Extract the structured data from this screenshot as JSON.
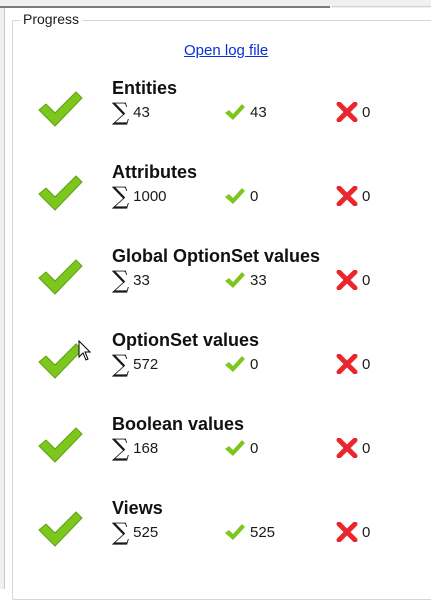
{
  "groupbox": {
    "title": "Progress"
  },
  "log_link": "Open log file",
  "colors": {
    "success": "#7dc61e",
    "error": "#e8262b",
    "link": "#0a2fd6"
  },
  "icons": {
    "total": "sigma-icon",
    "success": "check-icon",
    "error": "x-icon",
    "status": "large-check-icon"
  },
  "sections": [
    {
      "title": "Entities",
      "total": "43",
      "ok": "43",
      "errors": "0"
    },
    {
      "title": "Attributes",
      "total": "1000",
      "ok": "0",
      "errors": "0"
    },
    {
      "title": "Global OptionSet values",
      "total": "33",
      "ok": "33",
      "errors": "0"
    },
    {
      "title": "OptionSet values",
      "total": "572",
      "ok": "0",
      "errors": "0"
    },
    {
      "title": "Boolean values",
      "total": "168",
      "ok": "0",
      "errors": "0"
    },
    {
      "title": "Views",
      "total": "525",
      "ok": "525",
      "errors": "0"
    }
  ]
}
